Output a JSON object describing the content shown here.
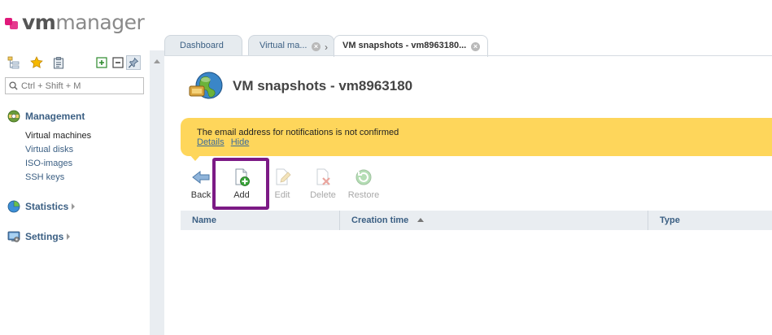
{
  "logo": {
    "vm": "vm",
    "manager": "manager"
  },
  "search": {
    "placeholder": "Ctrl + Shift + M"
  },
  "sidebar": {
    "management": "Management",
    "management_items": [
      "Virtual machines",
      "Virtual disks",
      "ISO-images",
      "SSH keys"
    ],
    "statistics": "Statistics",
    "settings": "Settings"
  },
  "tabs": [
    {
      "label": "Dashboard"
    },
    {
      "label": "Virtual ma..."
    },
    {
      "label": "VM snapshots - vm8963180..."
    }
  ],
  "page": {
    "title": "VM snapshots - vm8963180"
  },
  "notice": {
    "text": "The email address for notifications is not confirmed",
    "details": "Details",
    "hide": "Hide"
  },
  "toolbar": {
    "back": "Back",
    "add": "Add",
    "edit": "Edit",
    "delete": "Delete",
    "restore": "Restore"
  },
  "table": {
    "columns": [
      "Name",
      "Creation time",
      "Type"
    ],
    "sort_column": "Creation time",
    "sort_direction": "ascending"
  },
  "colors": {
    "accent_link": "#3b5f83",
    "notice_bg": "#fed65b",
    "highlight_border": "#7c1a85",
    "logo_pink": "#e0197a"
  }
}
